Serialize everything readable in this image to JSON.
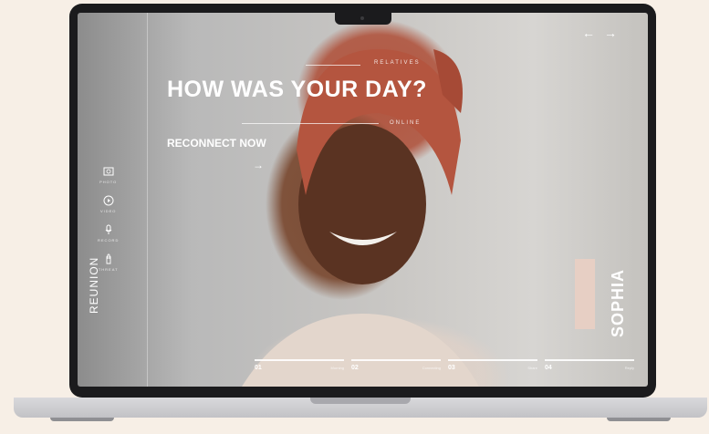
{
  "nav": {
    "prev_symbol": "←",
    "next_symbol": "→"
  },
  "tags": {
    "relatives": "RELATIVES",
    "online": "ONLINE"
  },
  "hero": {
    "headline": "HOW WAS YOUR DAY?",
    "cta_label": "RECONNECT NOW",
    "cta_arrow": "→"
  },
  "sidebar": {
    "items": [
      {
        "label": "PHOTO",
        "icon": "photo-icon"
      },
      {
        "label": "VIDEO",
        "icon": "video-icon"
      },
      {
        "label": "RECORD",
        "icon": "microphone-icon"
      },
      {
        "label": "THREAT",
        "icon": "hand-icon"
      }
    ]
  },
  "brand": {
    "logo_text": "REUNION"
  },
  "contact": {
    "name": "SOPHIA"
  },
  "steps": [
    {
      "num": "01",
      "label": "Morning"
    },
    {
      "num": "02",
      "label": "Connecting"
    },
    {
      "num": "03",
      "label": "Share"
    },
    {
      "num": "04",
      "label": "Reply"
    }
  ],
  "colors": {
    "accent": "#e7cfc4",
    "background": "#f7efe6",
    "bezel": "#1b1b1d"
  }
}
